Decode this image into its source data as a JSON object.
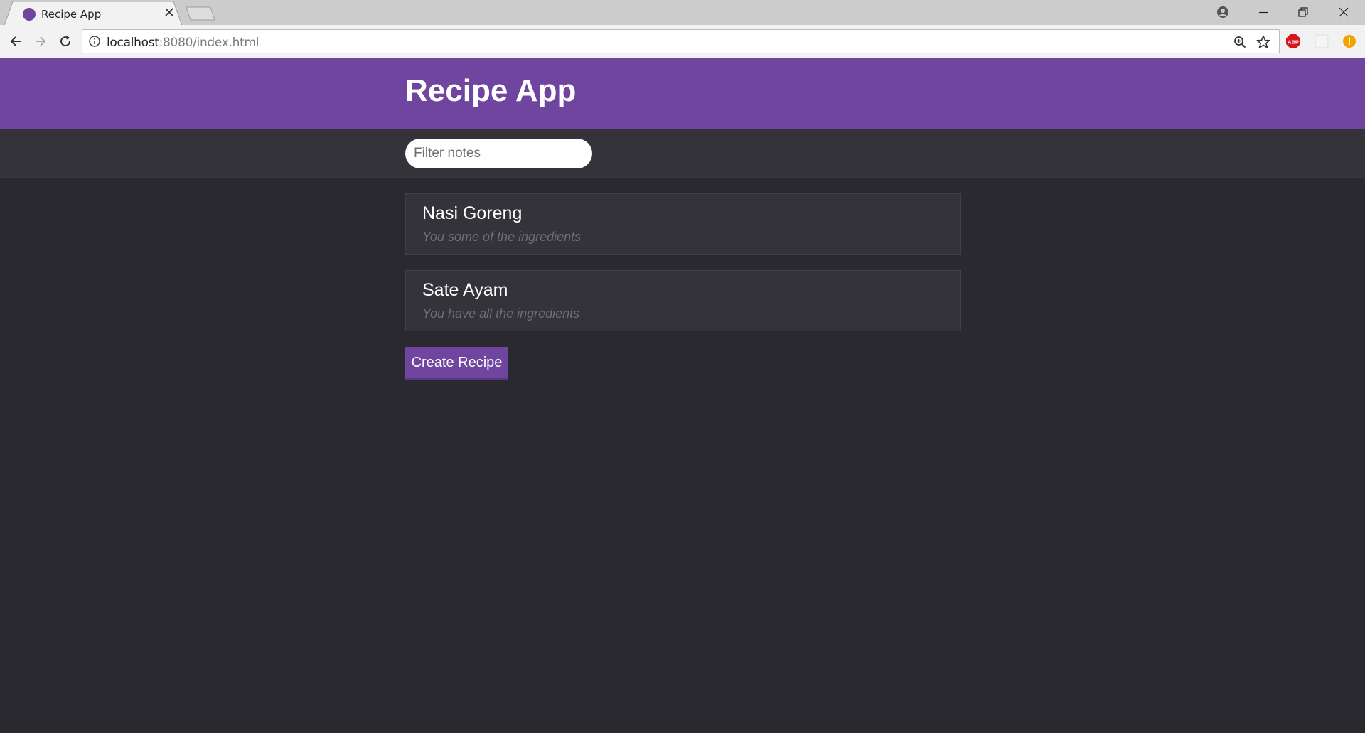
{
  "browser": {
    "tab_title": "Recipe App",
    "url_host": "localhost",
    "url_path": ":8080/index.html",
    "extensions": [
      "adblock-plus-icon",
      "blank-extension-icon",
      "warning-extension-icon"
    ]
  },
  "header": {
    "title": "Recipe App"
  },
  "filter": {
    "placeholder": "Filter notes",
    "value": ""
  },
  "recipes": [
    {
      "title": "Nasi Goreng",
      "status": "You some of the ingredients"
    },
    {
      "title": "Sate Ayam",
      "status": "You have all the ingredients"
    }
  ],
  "actions": {
    "create_label": "Create Recipe"
  },
  "colors": {
    "accent": "#6f45a0",
    "background": "#2a2930",
    "card": "#34333a"
  }
}
